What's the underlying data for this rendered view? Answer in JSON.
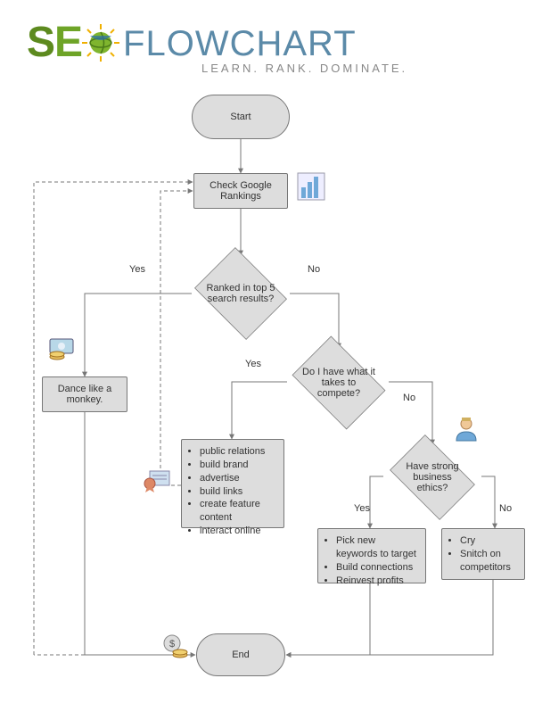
{
  "header": {
    "brand_s": "S",
    "brand_e": "E",
    "title_rest": "FLOWCHART",
    "tagline": "LEARN. RANK. DOMINATE."
  },
  "nodes": {
    "start": "Start",
    "check": "Check Google Rankings",
    "ranked": "Ranked in top 5 search results?",
    "dance": "Dance like a monkey.",
    "compete": "Do I have what it takes to compete?",
    "ethics": "Have strong business ethics?",
    "end": "End"
  },
  "lists": {
    "compete_yes": [
      "public relations",
      "build brand",
      "advertise",
      "build links",
      "create feature content",
      "interact online"
    ],
    "ethics_yes": [
      "Pick new keywords to target",
      "Build connections",
      "Reinvest profits"
    ],
    "ethics_no": [
      "Cry",
      "Snitch on competitors"
    ]
  },
  "labels": {
    "yes1": "Yes",
    "no1": "No",
    "yes2": "Yes",
    "no2": "No",
    "yes3": "Yes",
    "no3": "No"
  },
  "icons": {
    "chart": "bar-chart-icon",
    "money": "money-icon",
    "ribbon": "ribbon-certificate-icon",
    "person": "person-icon",
    "coins": "coins-icon"
  }
}
